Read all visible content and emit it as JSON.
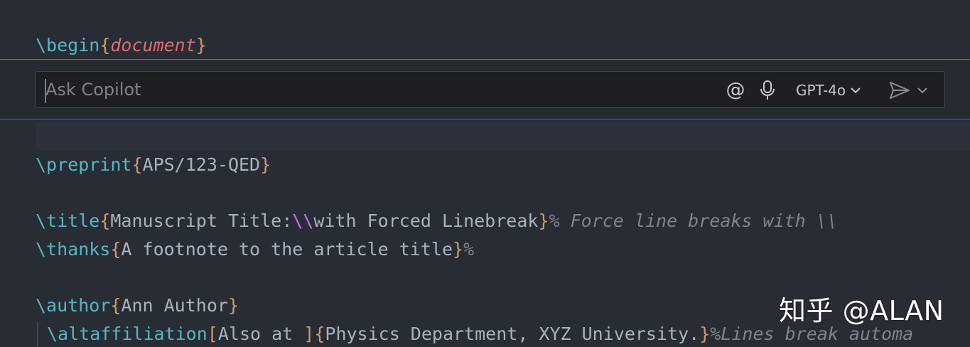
{
  "editor": {
    "line1": {
      "cmd": "\\begin",
      "open": "{",
      "arg": "document",
      "close": "}"
    },
    "line_preprint": {
      "cmd": "\\preprint",
      "open": "{",
      "arg": "APS/123-QED",
      "close": "}"
    },
    "line_title": {
      "cmd": "\\title",
      "open": "{",
      "text1": "Manuscript Title:",
      "linebreak": "\\\\",
      "text2": "with Forced Linebreak",
      "close": "}",
      "comment": "% Force line breaks with \\\\"
    },
    "line_thanks": {
      "cmd": "\\thanks",
      "open": "{",
      "arg": "A footnote to the article title",
      "close": "}",
      "comment": "%"
    },
    "line_author": {
      "cmd": "\\author",
      "open": "{",
      "arg": "Ann Author",
      "close": "}"
    },
    "line_altaff": {
      "cmd": "\\altaffiliation",
      "opt_open": "[",
      "opt": "Also at ",
      "opt_close": "]",
      "open": "{",
      "arg": "Physics Department, XYZ University.",
      "close": "}",
      "comment": "%Lines break automa"
    }
  },
  "copilot": {
    "placeholder": "Ask Copilot",
    "mention_icon": "at-icon",
    "mic_icon": "microphone-icon",
    "model": "GPT-4o",
    "send_icon": "send-icon"
  },
  "watermark": "知乎 @ALAN",
  "colors": {
    "background": "#282c34",
    "command": "#56b6c2",
    "brace": "#d19a66",
    "argument_italic": "#e06c75",
    "comment": "#7f848e",
    "zone_border": "#3b7bd4"
  }
}
